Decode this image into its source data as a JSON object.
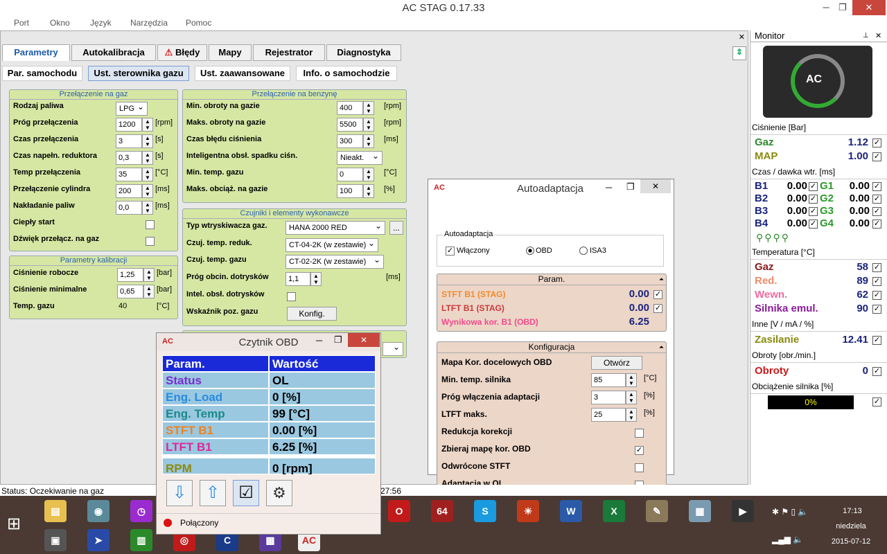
{
  "window": {
    "title": "AC STAG 0.17.33",
    "min": "─",
    "max": "❐",
    "close": "✕"
  },
  "menu": [
    "Port",
    "Okno",
    "Język",
    "Narzędzia",
    "Pomoc"
  ],
  "tabs": [
    "Parametry",
    "Autokalibracja",
    "Błędy",
    "Mapy",
    "Rejestrator",
    "Diagnostyka"
  ],
  "subtabs": [
    "Par. samochodu",
    "Ust. sterownika gazu",
    "Ust. zaawansowane",
    "Info. o samochodzie"
  ],
  "g1": {
    "title": "Przełączenie na gaz",
    "rows": [
      {
        "l": "Rodzaj paliwa",
        "v": "LPG"
      },
      {
        "l": "Próg przełączenia",
        "v": "1200",
        "u": "[rpm]"
      },
      {
        "l": "Czas przełączenia",
        "v": "3",
        "u": "[s]"
      },
      {
        "l": "Czas napełn. reduktora",
        "v": "0,3",
        "u": "[s]"
      },
      {
        "l": "Temp przełączenia",
        "v": "35",
        "u": "[°C]"
      },
      {
        "l": "Przełączenie cylindra",
        "v": "200",
        "u": "[ms]"
      },
      {
        "l": "Nakładanie paliw",
        "v": "0,0",
        "u": "[ms]"
      },
      {
        "l": "Ciepły start"
      },
      {
        "l": "Dźwięk przełącz. na gaz"
      }
    ]
  },
  "g2": {
    "title": "Parametry kalibracji",
    "rows": [
      {
        "l": "Ciśnienie robocze",
        "v": "1,25",
        "u": "[bar]"
      },
      {
        "l": "Ciśnienie minimalne",
        "v": "0,65",
        "u": "[bar]"
      },
      {
        "l": "Temp. gazu",
        "v": "40",
        "u": "[°C]"
      }
    ]
  },
  "g3": {
    "title": "Przełączenie na benzynę",
    "rows": [
      {
        "l": "Min. obroty na gazie",
        "v": "400",
        "u": "[rpm]"
      },
      {
        "l": "Maks. obroty na gazie",
        "v": "5500",
        "u": "[rpm]"
      },
      {
        "l": "Czas błędu ciśnienia",
        "v": "300",
        "u": "[ms]"
      },
      {
        "l": "Inteligentna obsł. spadku ciśn.",
        "v": "Nieakt."
      },
      {
        "l": "Min. temp. gazu",
        "v": "0",
        "u": "[°C]"
      },
      {
        "l": "Maks. obciąż. na gazie",
        "v": "100",
        "u": "[%]"
      }
    ]
  },
  "g4": {
    "title": "Czujniki i elementy wykonawcze",
    "rows": [
      {
        "l": "Typ wtryskiwacza gaz.",
        "v": "HANA 2000 RED"
      },
      {
        "l": "Czuj. temp. reduk.",
        "v": "CT-04-2K (w zestawie)"
      },
      {
        "l": "Czuj. temp. gazu",
        "v": "CT-02-2K (w zestawie)"
      },
      {
        "l": "Próg obcin. dotrysków",
        "v": "1,1",
        "u": "[ms]"
      },
      {
        "l": "Intel. obsł. dotrysków"
      },
      {
        "l": "Wskaźnik poz. gazu",
        "v": "Konfig."
      }
    ],
    "dots": "..."
  },
  "autoad": {
    "title": "Autoadaptacja",
    "sec": "Autoadaptacja",
    "enabled": "Włączony",
    "obd": "OBD",
    "isa": "ISA3",
    "param_title": "Param.",
    "params": [
      {
        "l": "STFT B1 (STAG)",
        "v": "0.00"
      },
      {
        "l": "LTFT B1 (STAG)",
        "v": "0.00"
      },
      {
        "l": "Wynikowa kor. B1 (OBD)",
        "v": "6.25"
      }
    ],
    "cfg_title": "Konfiguracja",
    "cfg": [
      {
        "l": "Mapa Kor. docelowych OBD",
        "v": "Otwórz"
      },
      {
        "l": "Min. temp. silnika",
        "v": "85",
        "u": "[°C]"
      },
      {
        "l": "Próg włączenia adaptacji",
        "v": "3",
        "u": "[%]"
      },
      {
        "l": "LTFT maks.",
        "v": "25",
        "u": "[%]"
      },
      {
        "l": "Redukcja korekcji"
      },
      {
        "l": "Zbieraj mapę kor. OBD"
      },
      {
        "l": "Odwrócone STFT"
      },
      {
        "l": "Adaptacja w OL"
      }
    ]
  },
  "obd": {
    "title": "Czytnik OBD",
    "h1": "Param.",
    "h2": "Wartość",
    "rows": [
      {
        "l": "Status",
        "v": "OL",
        "c": "#7a2bcf"
      },
      {
        "l": "Eng. Load",
        "v": "0 [%]",
        "c": "#2a8be0"
      },
      {
        "l": "Eng. Temp",
        "v": "99 [°C]",
        "c": "#1a8a8a"
      },
      {
        "l": "STFT B1",
        "v": "0.00 [%]",
        "c": "#f0821e"
      },
      {
        "l": "LTFT B1",
        "v": "6.25 [%]",
        "c": "#e0269a"
      },
      {
        "l": "RPM",
        "v": "0 [rpm]",
        "c": "#8a8a10"
      }
    ],
    "status": "Połączony"
  },
  "monitor": {
    "title": "Monitor",
    "h_press": "Ciśnienie [Bar]",
    "gaz": "Gaz",
    "gaz_v": "1.12",
    "map": "MAP",
    "map_v": "1.00",
    "h_inj": "Czas / dawka wtr. [ms]",
    "b": [
      {
        "l": "B1",
        "v": "0.00"
      },
      {
        "l": "B2",
        "v": "0.00"
      },
      {
        "l": "B3",
        "v": "0.00"
      },
      {
        "l": "B4",
        "v": "0.00"
      }
    ],
    "g": [
      {
        "l": "G1",
        "v": "0.00"
      },
      {
        "l": "G2",
        "v": "0.00"
      },
      {
        "l": "G3",
        "v": "0.00"
      },
      {
        "l": "G4",
        "v": "0.00"
      }
    ],
    "h_temp": "Temperatura [°C]",
    "temps": [
      {
        "l": "Gaz",
        "v": "58",
        "c": "#8a1a1a"
      },
      {
        "l": "Red.",
        "v": "89",
        "c": "#f08a6a"
      },
      {
        "l": "Wewn.",
        "v": "62",
        "c": "#f06aa0"
      },
      {
        "l": "Silnika emul.",
        "v": "90",
        "c": "#8a1a9a"
      }
    ],
    "h_other": "Inne [V / mA / %]",
    "zas": "Zasilanie",
    "zas_v": "12.41",
    "h_rpm": "Obroty [obr./min.]",
    "obr": "Obroty",
    "obr_v": "0",
    "h_load": "Obciążenie silnika [%]",
    "load": "0%"
  },
  "status": "Status: Oczekiwanie na gaz",
  "status_time": "27:56",
  "clock": {
    "time": "17:13",
    "day": "niedziela",
    "date": "2015-07-12"
  }
}
